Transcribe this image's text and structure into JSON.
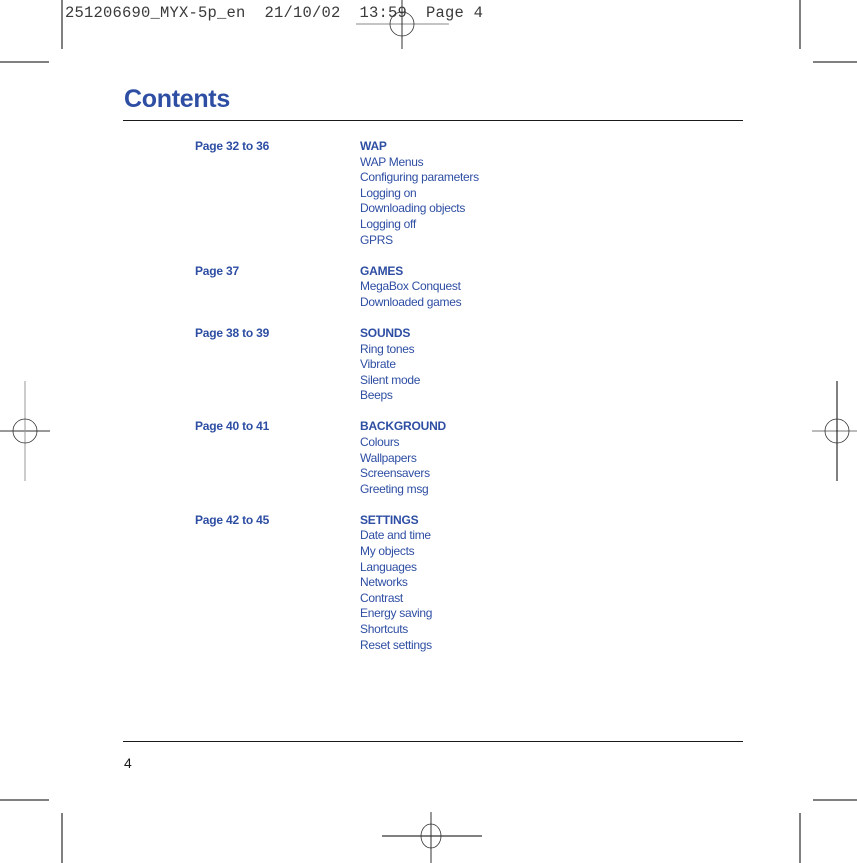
{
  "print_slug": "251206690_MYX-5p_en  21/10/02  13:59  Page 4",
  "title": "Contents",
  "page_number": "4",
  "colors": {
    "accent": "#2e4ea3",
    "rule": "#1a1a1a"
  },
  "sections": [
    {
      "pages": "Page 32 to 36",
      "heading": "WAP",
      "items": [
        "WAP Menus",
        "Configuring parameters",
        "Logging on",
        "Downloading objects",
        "Logging off",
        "GPRS"
      ]
    },
    {
      "pages": "Page 37",
      "heading": "GAMES",
      "items": [
        "MegaBox Conquest",
        "Downloaded games"
      ]
    },
    {
      "pages": "Page 38 to 39",
      "heading": "SOUNDS",
      "items": [
        "Ring tones",
        "Vibrate",
        "Silent mode",
        "Beeps"
      ]
    },
    {
      "pages": "Page 40 to 41",
      "heading": "BACKGROUND",
      "items": [
        "Colours",
        "Wallpapers",
        "Screensavers",
        "Greeting msg"
      ]
    },
    {
      "pages": "Page 42 to 45",
      "heading": "SETTINGS",
      "items": [
        "Date and time",
        "My objects",
        "Languages",
        "Networks",
        "Contrast",
        "Energy saving",
        "Shortcuts",
        "Reset settings"
      ]
    }
  ]
}
